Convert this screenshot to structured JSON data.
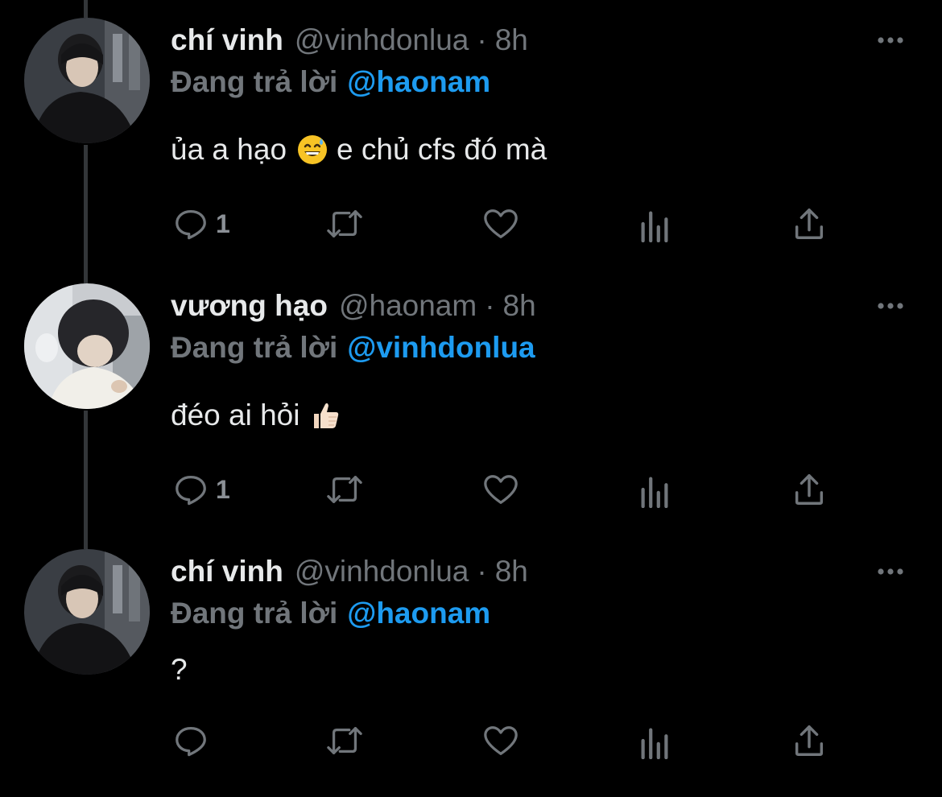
{
  "theme": {
    "background": "#000000",
    "text_primary": "#e7e9ea",
    "text_secondary": "#71767b",
    "accent": "#1d9bf0",
    "icon_color": "#71767b"
  },
  "tweets": [
    {
      "display_name": "chí vinh",
      "handle": "@vinhdonlua",
      "separator": "·",
      "time": "8h",
      "reply_prefix": "Đang trả lời",
      "reply_to": "@haonam",
      "text_before_emoji": "ủa a hạo",
      "emoji": "grinning-face-with-sweat-emoji",
      "text_after_emoji": "e chủ cfs đó mà",
      "reply_count": "1",
      "icons": [
        "reply-icon",
        "retweet-icon",
        "like-icon",
        "analytics-icon",
        "share-icon",
        "more-icon"
      ]
    },
    {
      "display_name": "vương hạo",
      "handle": "@haonam",
      "separator": "·",
      "time": "8h",
      "reply_prefix": "Đang trả lời",
      "reply_to": "@vinhdonlua",
      "text_before_emoji": "đéo ai hỏi",
      "emoji": "thumbs-up-emoji",
      "text_after_emoji": "",
      "reply_count": "1",
      "icons": [
        "reply-icon",
        "retweet-icon",
        "like-icon",
        "analytics-icon",
        "share-icon",
        "more-icon"
      ]
    },
    {
      "display_name": "chí vinh",
      "handle": "@vinhdonlua",
      "separator": "·",
      "time": "8h",
      "reply_prefix": "Đang trả lời",
      "reply_to": "@haonam",
      "text_before_emoji": "?",
      "emoji": "",
      "text_after_emoji": "",
      "reply_count": "",
      "icons": [
        "reply-icon",
        "retweet-icon",
        "like-icon",
        "analytics-icon",
        "share-icon",
        "more-icon"
      ]
    }
  ]
}
